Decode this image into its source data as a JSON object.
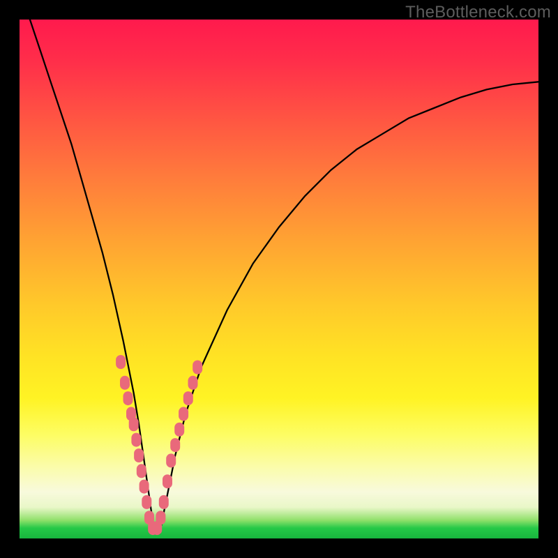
{
  "watermark": "TheBottleneck.com",
  "chart_data": {
    "type": "line",
    "title": "",
    "xlabel": "",
    "ylabel": "",
    "xlim": [
      0,
      100
    ],
    "ylim": [
      0,
      100
    ],
    "series": [
      {
        "name": "bottleneck-curve",
        "x": [
          2,
          4,
          6,
          8,
          10,
          12,
          14,
          16,
          18,
          20,
          22,
          23,
          24,
          25,
          26,
          27,
          28,
          29,
          30,
          32,
          35,
          40,
          45,
          50,
          55,
          60,
          65,
          70,
          75,
          80,
          85,
          90,
          95,
          100
        ],
        "values": [
          100,
          94,
          88,
          82,
          76,
          69,
          62,
          55,
          47,
          38,
          28,
          22,
          15,
          8,
          1,
          1,
          6,
          11,
          16,
          24,
          33,
          44,
          53,
          60,
          66,
          71,
          75,
          78,
          81,
          83,
          85,
          86.5,
          87.5,
          88
        ]
      }
    ],
    "markers": [
      {
        "x": 19.5,
        "y": 34
      },
      {
        "x": 20.3,
        "y": 30
      },
      {
        "x": 20.9,
        "y": 27
      },
      {
        "x": 21.5,
        "y": 24
      },
      {
        "x": 22.0,
        "y": 22
      },
      {
        "x": 22.5,
        "y": 19
      },
      {
        "x": 23.0,
        "y": 16
      },
      {
        "x": 23.5,
        "y": 13
      },
      {
        "x": 24.0,
        "y": 10
      },
      {
        "x": 24.5,
        "y": 7
      },
      {
        "x": 25.0,
        "y": 4
      },
      {
        "x": 25.7,
        "y": 2
      },
      {
        "x": 26.5,
        "y": 2
      },
      {
        "x": 27.2,
        "y": 4
      },
      {
        "x": 27.8,
        "y": 7
      },
      {
        "x": 28.5,
        "y": 11
      },
      {
        "x": 29.2,
        "y": 15
      },
      {
        "x": 30.0,
        "y": 18
      },
      {
        "x": 30.8,
        "y": 21
      },
      {
        "x": 31.6,
        "y": 24
      },
      {
        "x": 32.5,
        "y": 27
      },
      {
        "x": 33.4,
        "y": 30
      },
      {
        "x": 34.3,
        "y": 33
      }
    ],
    "marker_color": "#e9697b",
    "curve_color": "#000000"
  }
}
